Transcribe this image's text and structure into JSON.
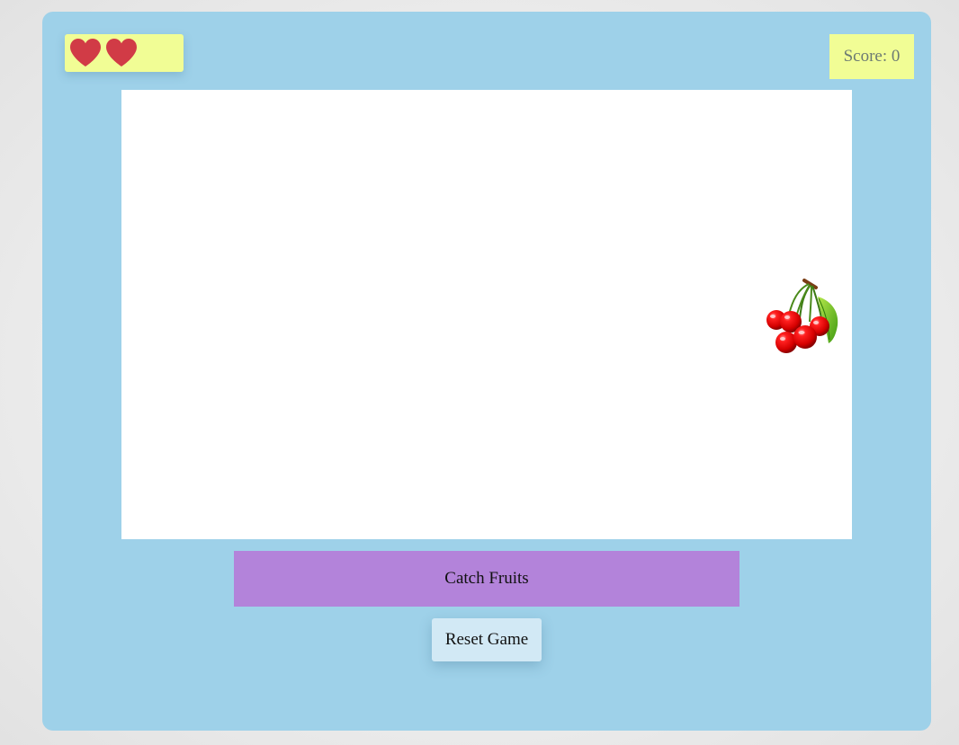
{
  "game": {
    "lives": 2,
    "score_text": "Score: 0",
    "title": "Catch Fruits",
    "reset_label": "Reset Game",
    "falling_item": "cherries-icon"
  },
  "colors": {
    "frame_bg": "#9ed1e9",
    "panel_bg": "#f1fd95",
    "heart": "#d13b46",
    "title_bar_bg": "#b383da",
    "reset_bg": "#d2e9f5",
    "play_area_bg": "#ffffff"
  },
  "icons": {
    "life": "heart-icon",
    "fruit": "cherries-icon"
  }
}
